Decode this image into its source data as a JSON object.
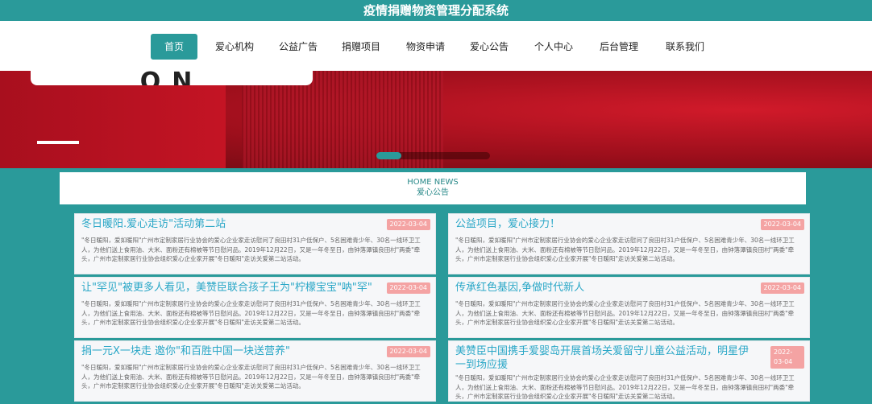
{
  "site": {
    "title": "疫情捐赠物资管理分配系统"
  },
  "nav": {
    "items": [
      {
        "label": "首页",
        "active": true
      },
      {
        "label": "爱心机构"
      },
      {
        "label": "公益广告"
      },
      {
        "label": "捐赠项目"
      },
      {
        "label": "物资申请"
      },
      {
        "label": "爱心公告"
      },
      {
        "label": "个人中心"
      },
      {
        "label": "后台管理"
      },
      {
        "label": "联系我们"
      }
    ]
  },
  "banner": {
    "sign_text": "PASS LOVE ON",
    "slide_progress": 0.22,
    "colors": {
      "accent": "#2a9a9a",
      "banner_red": "#b3182a"
    }
  },
  "news": {
    "heading_en": "HOME NEWS",
    "heading_cn": "爱心公告",
    "items": [
      {
        "title": "冬日暖阳.爱心走访\"活动第二站",
        "date": "2022-03-04",
        "summary": "\"冬日暖阳，爱如暖阳\"广州市定制家居行业协会的爱心企业家走访慰问了良田村31户低保户、5名困难青少年、30名一线环卫工人，为他们送上食用油、大米、面粉还有棉被等节日慰问品。2019年12月22日，又是一年冬至日，由钟落潭镇良田村\"两委\"牵头，广州市定制家居行业协会组织爱心企业家开展\"冬日暖阳\"走访关爱第二站活动。"
      },
      {
        "title": "公益项目，爱心接力！",
        "date": "2022-03-04",
        "summary": "\"冬日暖阳，爱如暖阳\"广州市定制家居行业协会的爱心企业家走访慰问了良田村31户低保户、5名困难青少年、30名一线环卫工人，为他们送上食用油、大米、面粉还有棉被等节日慰问品。2019年12月22日，又是一年冬至日，由钟落潭镇良田村\"两委\"牵头，广州市定制家居行业协会组织爱心企业家开展\"冬日暖阳\"走访关爱第二站活动。"
      },
      {
        "title": "让\"罕见\"被更多人看见，美赞臣联合孩子王为\"柠檬宝宝\"呐\"罕\"",
        "date": "2022-03-04",
        "summary": "\"冬日暖阳，爱如暖阳\"广州市定制家居行业协会的爱心企业家走访慰问了良田村31户低保户、5名困难青少年、30名一线环卫工人，为他们送上食用油、大米、面粉还有棉被等节日慰问品。2019年12月22日，又是一年冬至日，由钟落潭镇良田村\"两委\"牵头，广州市定制家居行业协会组织爱心企业家开展\"冬日暖阳\"走访关爱第二站活动。"
      },
      {
        "title": "传承红色基因,争做时代新人",
        "date": "2022-03-04",
        "summary": "\"冬日暖阳，爱如暖阳\"广州市定制家居行业协会的爱心企业家走访慰问了良田村31户低保户、5名困难青少年、30名一线环卫工人，为他们送上食用油、大米、面粉还有棉被等节日慰问品。2019年12月22日，又是一年冬至日，由钟落潭镇良田村\"两委\"牵头，广州市定制家居行业协会组织爱心企业家开展\"冬日暖阳\"走访关爱第二站活动。"
      },
      {
        "title": "捐一元X一块走 邀你\"和百胜中国一块送营养\"",
        "date": "2022-03-04",
        "summary": "\"冬日暖阳，爱如暖阳\"广州市定制家居行业协会的爱心企业家走访慰问了良田村31户低保户、5名困难青少年、30名一线环卫工人，为他们送上食用油、大米、面粉还有棉被等节日慰问品。2019年12月22日，又是一年冬至日，由钟落潭镇良田村\"两委\"牵头，广州市定制家居行业协会组织爱心企业家开展\"冬日暖阳\"走访关爱第二站活动。"
      },
      {
        "title": "美赞臣中国携手爱婴岛开展首场关爱留守儿童公益活动，明星伊一到场应援",
        "date": "2022-03-04",
        "summary": "\"冬日暖阳，爱如暖阳\"广州市定制家居行业协会的爱心企业家走访慰问了良田村31户低保户、5名困难青少年、30名一线环卫工人，为他们送上食用油、大米、面粉还有棉被等节日慰问品。2019年12月22日，又是一年冬至日，由钟落潭镇良田村\"两委\"牵头，广州市定制家居行业协会组织爱心企业家开展\"冬日暖阳\"走访关爱第二站活动。"
      }
    ]
  }
}
